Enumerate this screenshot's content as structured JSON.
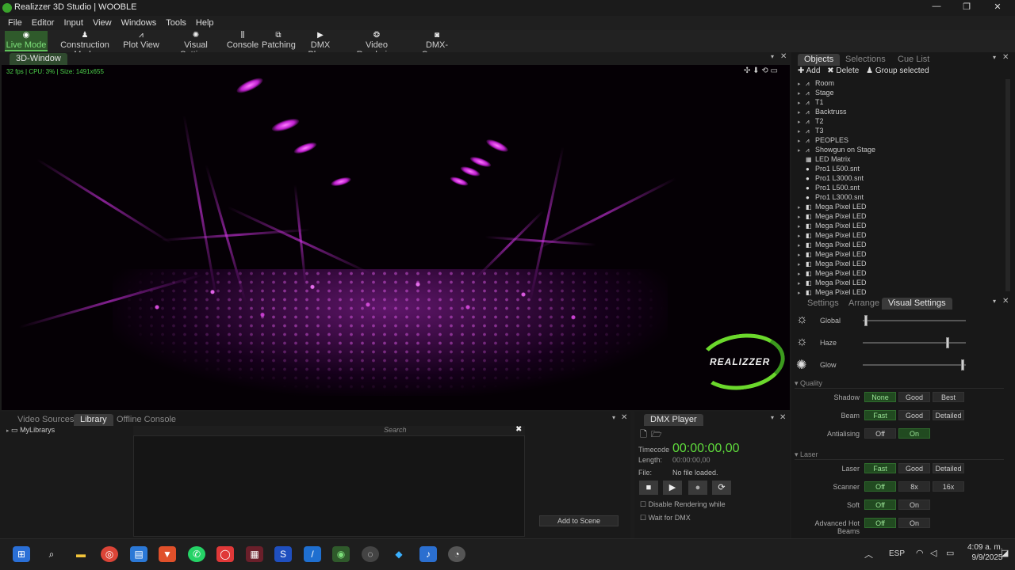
{
  "window": {
    "title": "Realizzer 3D Studio | WOOBLE",
    "min": "—",
    "max": "❐",
    "close": "✕"
  },
  "menu": [
    "File",
    "Editor",
    "Input",
    "View",
    "Windows",
    "Tools",
    "Help"
  ],
  "modes": [
    {
      "label": "Live Mode",
      "icon": "eye-icon",
      "glyph": "◉"
    },
    {
      "label": "Construction Mode",
      "icon": "person-icon",
      "glyph": "♟"
    },
    {
      "label": "Plot View",
      "icon": "tripod-icon",
      "glyph": "⩘"
    },
    {
      "label": "Visual Settings",
      "icon": "gear-icon",
      "glyph": "✺"
    },
    {
      "label": "Console",
      "icon": "faders-icon",
      "glyph": "⫼"
    },
    {
      "label": "Patching",
      "icon": "patch-icon",
      "glyph": "⧉"
    },
    {
      "label": "DMX Player",
      "icon": "play-icon",
      "glyph": "▶"
    },
    {
      "label": "Video Rendering",
      "icon": "film-reel-icon",
      "glyph": "❂"
    },
    {
      "label": "DMX-Camera",
      "icon": "camera-icon",
      "glyph": "◙"
    }
  ],
  "view3d": {
    "tab": "3D-Window",
    "stats": "32 fps | CPU: 3% | Size: 1491x655",
    "logo": "REALIZZER"
  },
  "objects": {
    "tabs": [
      "Objects",
      "Selections",
      "Cue List"
    ],
    "add": "Add",
    "delete": "Delete",
    "group": "Group selected",
    "items": [
      {
        "label": "Room",
        "exp": true,
        "icon": "⩘"
      },
      {
        "label": "Stage",
        "exp": true,
        "icon": "⩘"
      },
      {
        "label": "T1",
        "exp": true,
        "icon": "⩘"
      },
      {
        "label": "Backtruss",
        "exp": true,
        "icon": "⩘"
      },
      {
        "label": "T2",
        "exp": true,
        "icon": "⩘"
      },
      {
        "label": "T3",
        "exp": true,
        "icon": "⩘"
      },
      {
        "label": "PEOPLES",
        "exp": true,
        "icon": "⩘"
      },
      {
        "label": "Showgun on Stage",
        "exp": true,
        "icon": "⩘"
      },
      {
        "label": "LED Matrix",
        "exp": false,
        "icon": "▦"
      },
      {
        "label": "Pro1 L500.snt",
        "exp": false,
        "icon": "●"
      },
      {
        "label": "Pro1 L3000.snt",
        "exp": false,
        "icon": "●"
      },
      {
        "label": "Pro1 L500.snt",
        "exp": false,
        "icon": "●"
      },
      {
        "label": "Pro1 L3000.snt",
        "exp": false,
        "icon": "●"
      },
      {
        "label": "Mega Pixel LED",
        "exp": true,
        "icon": "◧"
      },
      {
        "label": "Mega Pixel LED",
        "exp": true,
        "icon": "◧"
      },
      {
        "label": "Mega Pixel LED",
        "exp": true,
        "icon": "◧"
      },
      {
        "label": "Mega Pixel LED",
        "exp": true,
        "icon": "◧"
      },
      {
        "label": "Mega Pixel LED",
        "exp": true,
        "icon": "◧"
      },
      {
        "label": "Mega Pixel LED",
        "exp": true,
        "icon": "◧"
      },
      {
        "label": "Mega Pixel LED",
        "exp": true,
        "icon": "◧"
      },
      {
        "label": "Mega Pixel LED",
        "exp": true,
        "icon": "◧"
      },
      {
        "label": "Mega Pixel LED",
        "exp": true,
        "icon": "◧"
      },
      {
        "label": "Mega Pixel LED",
        "exp": true,
        "icon": "◧"
      }
    ]
  },
  "visual": {
    "tabs": [
      "Settings",
      "Arrange",
      "Visual Settings"
    ],
    "sliders": [
      {
        "label": "Global",
        "level": 0.02
      },
      {
        "label": "Haze",
        "level": 0.85
      },
      {
        "label": "Glow",
        "level": 1.0
      }
    ],
    "quality": {
      "header": "Quality",
      "rows": [
        {
          "label": "Shadow",
          "opts": [
            "None",
            "Good",
            "Best"
          ],
          "sel": 0
        },
        {
          "label": "Beam",
          "opts": [
            "Fast",
            "Good",
            "Detailed"
          ],
          "sel": 0
        },
        {
          "label": "Antialising",
          "opts": [
            "Off",
            "On"
          ],
          "sel": 1
        }
      ]
    },
    "laser": {
      "header": "Laser",
      "rows": [
        {
          "label": "Laser",
          "opts": [
            "Fast",
            "Good",
            "Detailed"
          ],
          "sel": 0
        },
        {
          "label": "Scanner",
          "opts": [
            "Off",
            "8x",
            "16x"
          ],
          "sel": 0
        },
        {
          "label": "Soft",
          "opts": [
            "Off",
            "On"
          ],
          "sel": 0
        },
        {
          "label": "Advanced Hot Beams",
          "opts": [
            "Off",
            "On"
          ],
          "sel": 0
        }
      ]
    }
  },
  "library": {
    "tabs": [
      "Video Sources",
      "Library",
      "Offline Console"
    ],
    "root": "MyLibrarys",
    "search": "Search",
    "add": "Add to Scene"
  },
  "dmx": {
    "tab": "DMX Player",
    "timecode_label": "Timecode",
    "timecode": "00:00:00,00",
    "length_label": "Length:",
    "length": "00:00:00,00",
    "file_label": "File:",
    "file": "No file loaded.",
    "disable": "Disable Rendering while",
    "wait": "Wait for DMX"
  },
  "taskbar": {
    "lang": "ESP",
    "time": "4:09 a. m.",
    "date": "9/9/2025"
  }
}
